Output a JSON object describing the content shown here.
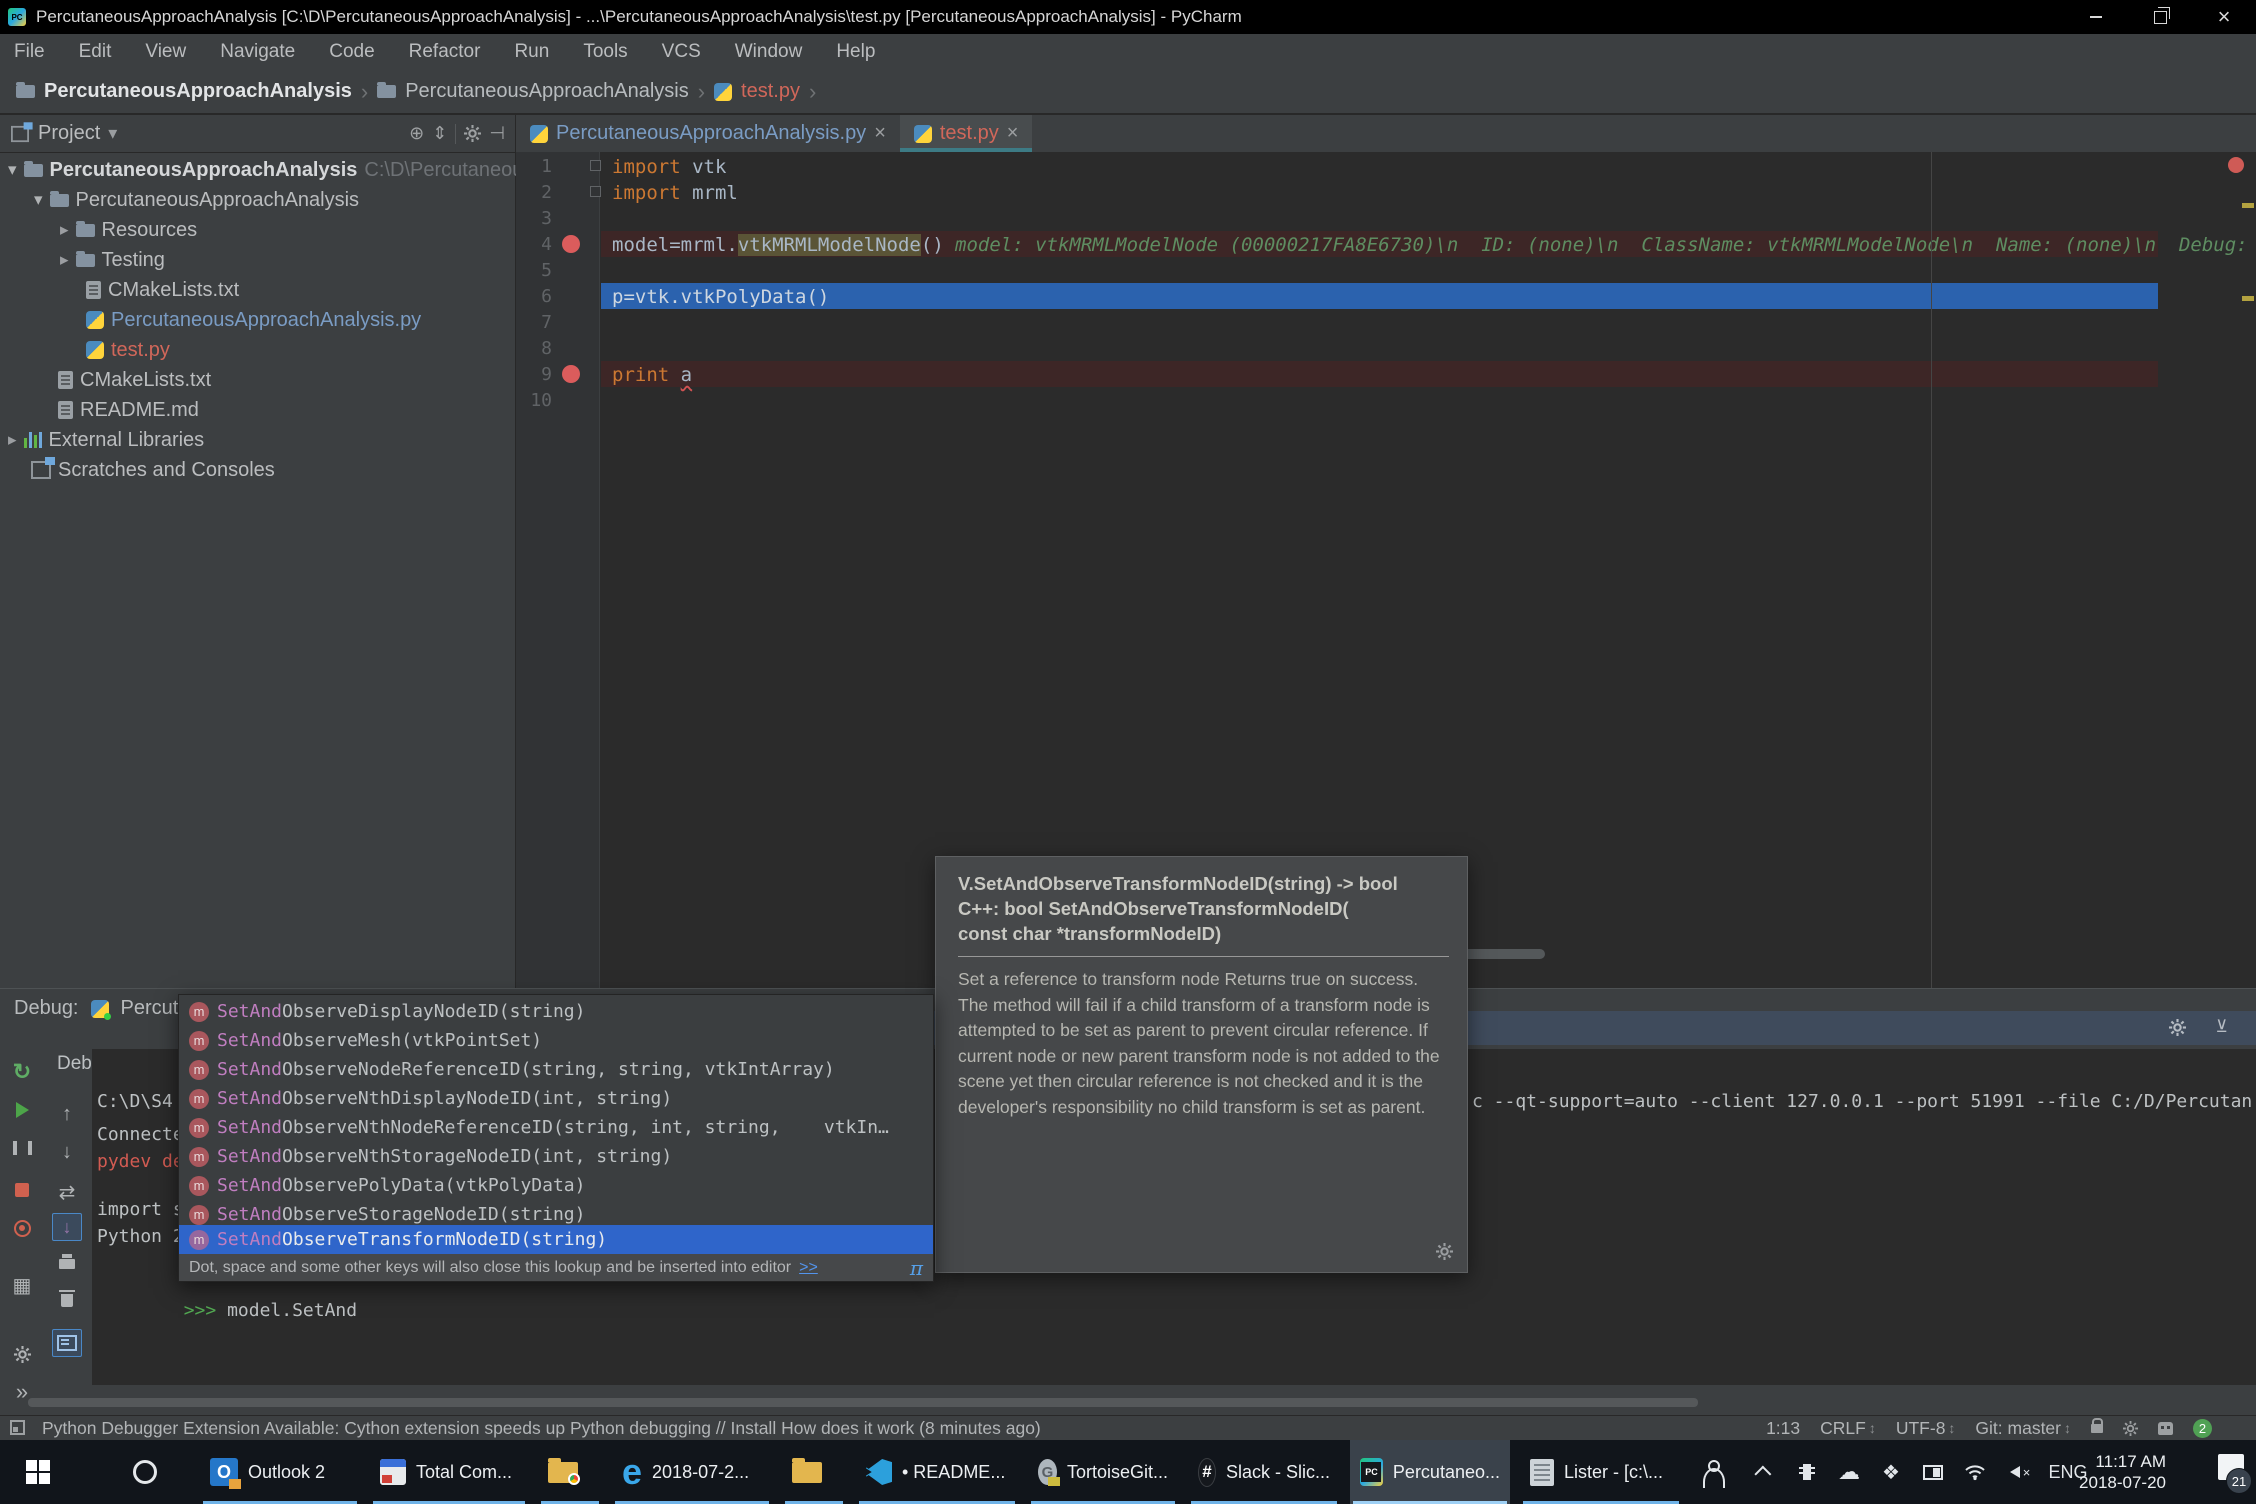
{
  "window": {
    "title": "PercutaneousApproachAnalysis [C:\\D\\PercutaneousApproachAnalysis] - ...\\PercutaneousApproachAnalysis\\test.py [PercutaneousApproachAnalysis] - PyCharm"
  },
  "menu": [
    "File",
    "Edit",
    "View",
    "Navigate",
    "Code",
    "Refactor",
    "Run",
    "Tools",
    "VCS",
    "Window",
    "Help"
  ],
  "toolbar": {
    "breadcrumbs": [
      "PercutaneousApproachAnalysis",
      "PercutaneousApproachAnalysis",
      "test.py"
    ],
    "run_config": "PercutaneousApproachAnalysis"
  },
  "project": {
    "header": "Project",
    "items": [
      {
        "label": "PercutaneousApproachAnalysis",
        "path": "C:\\D\\PercutaneousApp"
      },
      {
        "label": "PercutaneousApproachAnalysis"
      },
      {
        "label": "Resources"
      },
      {
        "label": "Testing"
      },
      {
        "label": "CMakeLists.txt"
      },
      {
        "label": "PercutaneousApproachAnalysis.py"
      },
      {
        "label": "test.py"
      },
      {
        "label": "CMakeLists.txt"
      },
      {
        "label": "README.md"
      },
      {
        "label": "External Libraries"
      },
      {
        "label": "Scratches and Consoles"
      }
    ]
  },
  "editor": {
    "tabs": [
      "PercutaneousApproachAnalysis.py",
      "test.py"
    ],
    "gutter": [
      "1",
      "2",
      "3",
      "4",
      "5",
      "6",
      "7",
      "8",
      "9",
      "10"
    ],
    "code": {
      "line1_kw": "import",
      "line1_id": "vtk",
      "line2_kw": "import",
      "line2_id": "mrml",
      "line4_pre": "model=mrml.",
      "line4_hl": "vtkMRMLModelNode",
      "line4_post": "()",
      "line4_inline": "model: vtkMRMLModelNode (00000217FA8E6730)\\n  ID: (none)\\n  ClassName: vtkMRMLModelNode\\n  Name: (none)\\n  Debug: fals",
      "line6": "p=vtk.vtkPolyData()",
      "line9_kw": "print",
      "line9_id": "a"
    }
  },
  "completion": {
    "items": [
      {
        "match": "SetAnd",
        "rest": "ObserveDisplayNodeID(string)"
      },
      {
        "match": "SetAnd",
        "rest": "ObserveMesh(vtkPointSet)"
      },
      {
        "match": "SetAnd",
        "rest": "ObserveNodeReferenceID(string, string, vtkIntArray)"
      },
      {
        "match": "SetAnd",
        "rest": "ObserveNthDisplayNodeID(int, string)"
      },
      {
        "match": "SetAnd",
        "rest": "ObserveNthNodeReferenceID(string, int, string,    vtkIn…"
      },
      {
        "match": "SetAnd",
        "rest": "ObserveNthStorageNodeID(int, string)"
      },
      {
        "match": "SetAnd",
        "rest": "ObservePolyData(vtkPolyData)"
      },
      {
        "match": "SetAnd",
        "rest": "ObserveStorageNodeID(string)"
      },
      {
        "match": "SetAnd",
        "rest": "ObserveTransformNodeID(string)"
      }
    ],
    "hint": "Dot, space and some other keys will also close this lookup and be inserted into editor",
    "hint_link": ">>",
    "pi": "π"
  },
  "doc_popup": {
    "signature_line1": "V.SetAndObserveTransformNodeID(string) -> bool",
    "signature_line2": "C++: bool SetAndObserveTransformNodeID(",
    "signature_line3": "const char *transformNodeID)",
    "body": "Set a reference to transform node Returns true on success. The method will fail if a child transform of a transform node is attempted to be set as parent to prevent circular reference. If current node or new parent transform node is not added to the scene yet then circular reference is not checked and it is the developer's responsibility no child transform is set as parent."
  },
  "debug": {
    "label": "Debug:",
    "session": "Percuta",
    "tab_debugger": "Debugger",
    "console_line1_left": "C:\\D\\S4",
    "console_line1_right": "c --qt-support=auto --client 127.0.0.1 --port 51991 --file C:/D/Percutan",
    "console_line2": "Connecte",
    "console_line3": "pydev de",
    "console_line4": "import s",
    "console_line5": "Python 2",
    "prompt": ">>>",
    "prompt_input": "model.SetAnd"
  },
  "status": {
    "message": "Python Debugger Extension Available: Cython extension speeds up Python debugging // Install How does it work (8 minutes ago)",
    "line_col": "1:13",
    "line_sep": "CRLF",
    "encoding": "UTF-8",
    "git": "Git: master",
    "badge": "2"
  },
  "taskbar": {
    "apps": [
      {
        "label": "Outlook 2"
      },
      {
        "label": "Total Com..."
      },
      {
        "label": ""
      },
      {
        "label": "2018-07-2..."
      },
      {
        "label": ""
      },
      {
        "label": "• README..."
      },
      {
        "label": "TortoiseGit..."
      },
      {
        "label": "Slack - Slic..."
      },
      {
        "label": "Percutaneo..."
      },
      {
        "label": "Lister - [c:\\..."
      }
    ],
    "lang": "ENG",
    "time": "11:17 AM",
    "date": "2018-07-20",
    "notif_badge": "21"
  }
}
